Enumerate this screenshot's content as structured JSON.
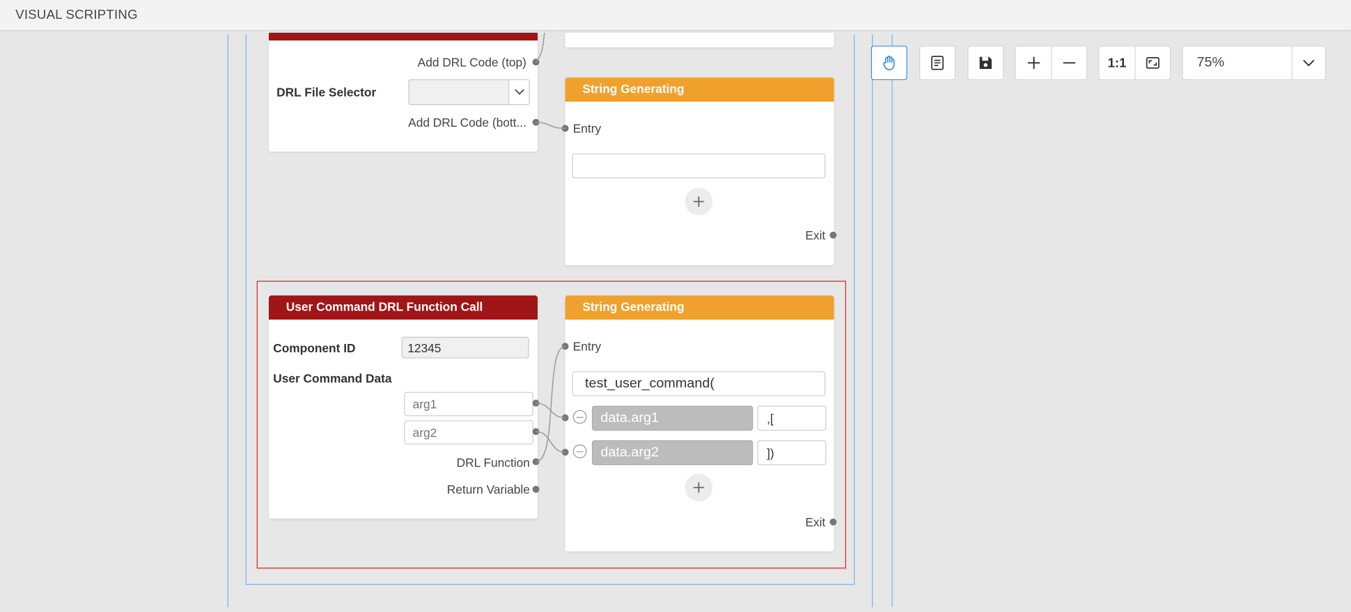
{
  "header": {
    "title": "VISUAL SCRIPTING"
  },
  "top_node": {
    "add_top_label": "Add DRL Code (top)",
    "file_selector_label": "DRL File Selector",
    "file_selector_value": "",
    "add_bottom_label": "Add DRL Code (bott..."
  },
  "top_string_node": {
    "title": "String Generating",
    "entry_label": "Entry",
    "field_value": "",
    "exit_label": "Exit"
  },
  "ucmd_node": {
    "title": "User Command DRL Function Call",
    "component_id_label": "Component ID",
    "component_id_value": "12345",
    "user_command_data_label": "User Command Data",
    "arg1_placeholder": "arg1",
    "arg2_placeholder": "arg2",
    "drl_function_label": "DRL Function",
    "return_variable_label": "Return Variable"
  },
  "string_node": {
    "title": "String Generating",
    "entry_label": "Entry",
    "command_value": "test_user_command(",
    "rows": [
      {
        "chip": "data.arg1",
        "suffix": ",["
      },
      {
        "chip": "data.arg2",
        "suffix": "])"
      }
    ],
    "exit_label": "Exit"
  },
  "toolbar": {
    "one_to_one": "1:1",
    "zoom_value": "75%"
  },
  "colors": {
    "accent_red": "#a01515",
    "accent_orange": "#f0a02c",
    "selection_red": "#e02020",
    "guide_blue": "#7eb3e8"
  }
}
